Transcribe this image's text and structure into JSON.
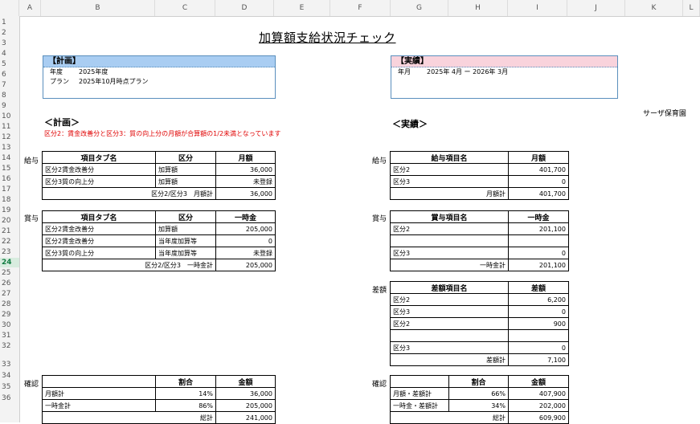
{
  "columns": [
    "A",
    "B",
    "C",
    "D",
    "E",
    "F",
    "G",
    "H",
    "I",
    "J",
    "K",
    "L"
  ],
  "rows": [
    "1",
    "2",
    "3",
    "4",
    "5",
    "6",
    "7",
    "8",
    "9",
    "10",
    "11",
    "12",
    "13",
    "14",
    "15",
    "16",
    "17",
    "18",
    "19",
    "20",
    "21",
    "22",
    "23",
    "24",
    "25",
    "26",
    "27",
    "28",
    "29",
    "30",
    "31",
    "32",
    "33",
    "34",
    "35",
    "36"
  ],
  "selected_row": "24",
  "sheet": {
    "title": "加算額支給状況チェック",
    "facility": "サーザ保育園",
    "plan_box": {
      "header": "【計画】",
      "row1_label": "年度",
      "row1_value": "2025年度",
      "row2_label": "プラン",
      "row2_value": "2025年10月時点プラン"
    },
    "actual_box": {
      "header": "【実績】",
      "label": "年月",
      "value": "2025年 4月 ー 2026年 3月"
    },
    "plan_section": "＜計画＞",
    "actual_section": "＜実績＞",
    "note": "区分2：賃金改善分と区分3：質の向上分の月額が合算額の1/2未満となっています",
    "plan_salary": {
      "side": "給与",
      "headers": [
        "項目タブ名",
        "区分",
        "月額"
      ],
      "rows": [
        [
          "区分2賃金改善分",
          "加算額",
          "36,000"
        ],
        [
          "区分3質の向上分",
          "加算額",
          "未登録"
        ]
      ],
      "total_label": "区分2/区分3　月額計",
      "total_value": "36,000"
    },
    "plan_bonus": {
      "side": "賞与",
      "headers": [
        "項目タブ名",
        "区分",
        "一時金"
      ],
      "rows": [
        [
          "区分2賃金改善分",
          "加算額",
          "205,000"
        ],
        [
          "区分2賃金改善分",
          "当年度加算等",
          "0"
        ],
        [
          "区分3質の向上分",
          "当年度加算等",
          "未登録"
        ]
      ],
      "total_label": "区分2/区分3　一時金計",
      "total_value": "205,000"
    },
    "plan_confirm": {
      "side": "確認",
      "headers": [
        "",
        "割合",
        "金額"
      ],
      "rows": [
        [
          "月額計",
          "14%",
          "36,000"
        ],
        [
          "一時金計",
          "86%",
          "205,000"
        ]
      ],
      "total_label": "総計",
      "total_value": "241,000"
    },
    "actual_salary": {
      "side": "給与",
      "headers": [
        "給与項目名",
        "月額"
      ],
      "rows": [
        [
          "区分2",
          "401,700"
        ],
        [
          "区分3",
          "0"
        ]
      ],
      "total_label": "月額計",
      "total_value": "401,700"
    },
    "actual_bonus": {
      "side": "賞与",
      "headers": [
        "賞与項目名",
        "一時金"
      ],
      "rows": [
        [
          "区分2",
          "201,100"
        ],
        [
          "",
          ""
        ],
        [
          "区分3",
          "0"
        ]
      ],
      "total_label": "一時金計",
      "total_value": "201,100"
    },
    "actual_diff": {
      "side": "差額",
      "headers": [
        "差額項目名",
        "差額"
      ],
      "rows": [
        [
          "区分2",
          "6,200"
        ],
        [
          "区分3",
          "0"
        ],
        [
          "区分2",
          "900"
        ],
        [
          "",
          ""
        ],
        [
          "区分3",
          "0"
        ]
      ],
      "total_label": "差額計",
      "total_value": "7,100"
    },
    "actual_confirm": {
      "side": "確認",
      "headers": [
        "",
        "割合",
        "金額"
      ],
      "rows": [
        [
          "月額・差額計",
          "66%",
          "407,900"
        ],
        [
          "一時金・差額計",
          "34%",
          "202,000"
        ]
      ],
      "total_label": "総計",
      "total_value": "609,900"
    }
  }
}
